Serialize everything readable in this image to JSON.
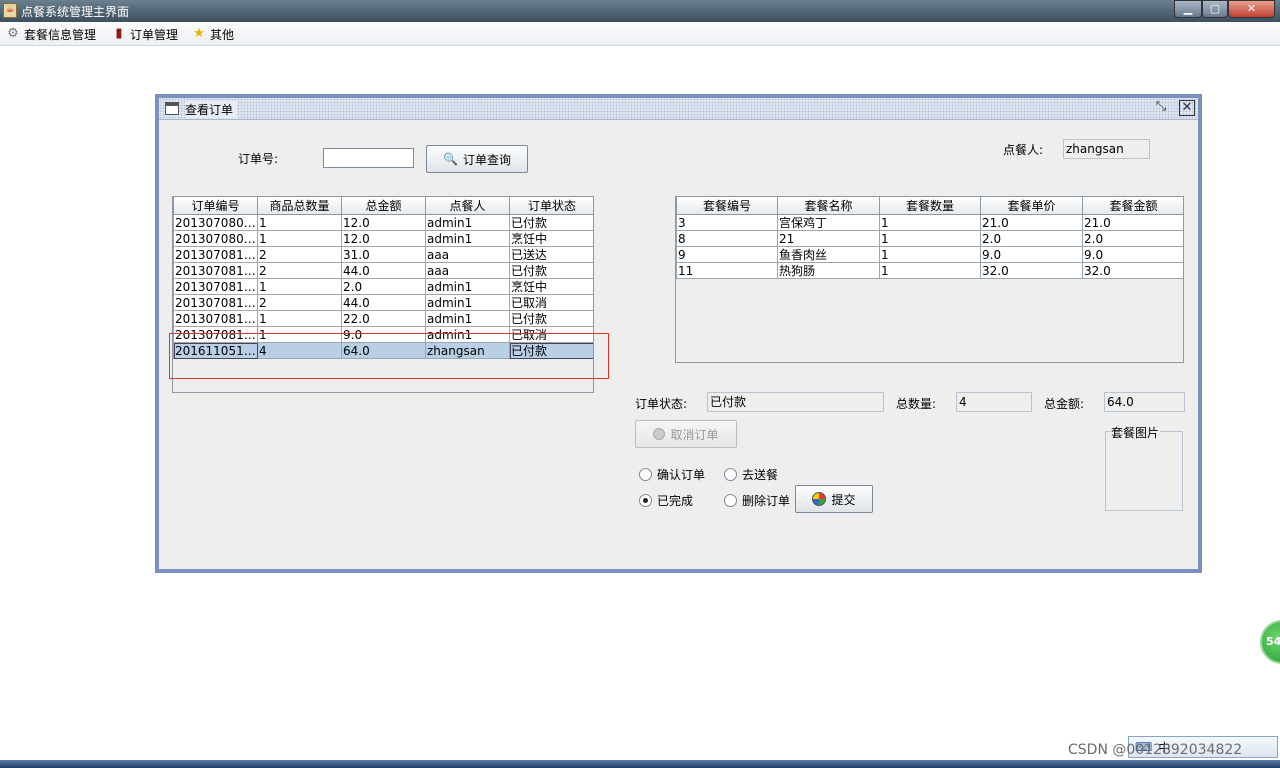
{
  "window": {
    "title": "点餐系统管理主界面",
    "app_icon": "java-cup-icon"
  },
  "menubar": {
    "items": [
      {
        "label": "套餐信息管理",
        "icon": "gear-icon"
      },
      {
        "label": "订单管理",
        "icon": "book-icon"
      },
      {
        "label": "其他",
        "icon": "star-icon"
      }
    ]
  },
  "frame": {
    "title": "查看订单",
    "search": {
      "order_no_label": "订单号:",
      "order_no_value": "",
      "query_button": "订单查询"
    },
    "customer": {
      "label": "点餐人:",
      "value": "zhangsan"
    },
    "orders_table": {
      "headers": [
        "订单编号",
        "商品总数量",
        "总金额",
        "点餐人",
        "订单状态"
      ],
      "rows": [
        [
          "2013070800...",
          "1",
          "12.0",
          "admin1",
          "已付款"
        ],
        [
          "2013070802...",
          "1",
          "12.0",
          "admin1",
          "烹饪中"
        ],
        [
          "2013070811...",
          "2",
          "31.0",
          "aaa",
          "已送达"
        ],
        [
          "2013070811...",
          "2",
          "44.0",
          "aaa",
          "已付款"
        ],
        [
          "2013070811...",
          "1",
          "2.0",
          "admin1",
          "烹饪中"
        ],
        [
          "2013070811...",
          "2",
          "44.0",
          "admin1",
          "已取消"
        ],
        [
          "2013070811...",
          "1",
          "22.0",
          "admin1",
          "已付款"
        ],
        [
          "2013070812...",
          "1",
          "9.0",
          "admin1",
          "已取消"
        ],
        [
          "2016110517...",
          "4",
          "64.0",
          "zhangsan",
          "已付款"
        ]
      ],
      "selected_row": 8
    },
    "items_table": {
      "headers": [
        "套餐编号",
        "套餐名称",
        "套餐数量",
        "套餐单价",
        "套餐金额"
      ],
      "rows": [
        [
          "3",
          "宫保鸡丁",
          "1",
          "21.0",
          "21.0"
        ],
        [
          "8",
          "21",
          "1",
          "2.0",
          "2.0"
        ],
        [
          "9",
          "鱼香肉丝",
          "1",
          "9.0",
          "9.0"
        ],
        [
          "11",
          "热狗肠",
          "1",
          "32.0",
          "32.0"
        ]
      ]
    },
    "summary": {
      "status_label": "订单状态:",
      "status_value": "已付款",
      "qty_label": "总数量:",
      "qty_value": "4",
      "amount_label": "总金额:",
      "amount_value": "64.0"
    },
    "cancel_button": "取消订单",
    "image_group_label": "套餐图片",
    "radios": [
      {
        "label": "确认订单",
        "checked": false
      },
      {
        "label": "去送餐",
        "checked": false
      },
      {
        "label": "已完成",
        "checked": true
      },
      {
        "label": "删除订单",
        "checked": false
      }
    ],
    "submit_button": "提交"
  },
  "overlay": {
    "badge_text": "54",
    "watermark": "CSDN @0012892034822",
    "ime_text": "中"
  }
}
